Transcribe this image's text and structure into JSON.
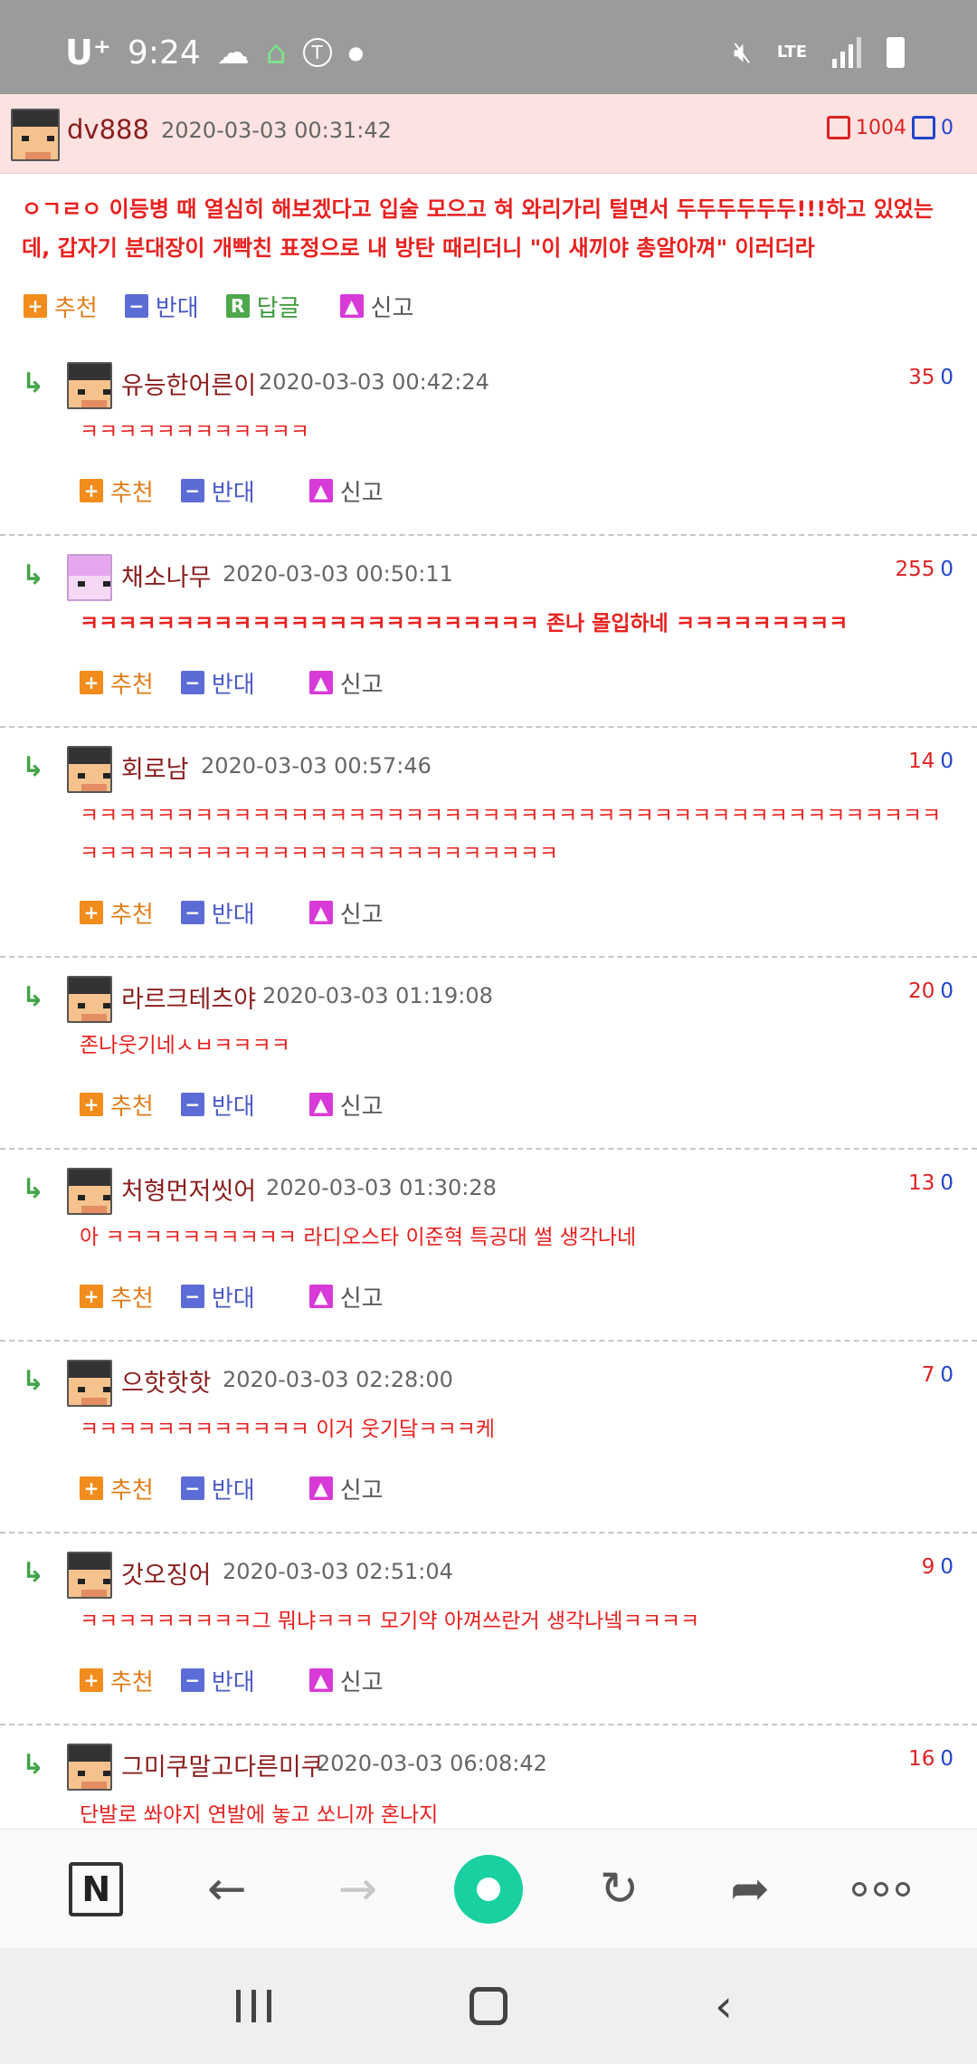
{
  "status_bar": {
    "carrier": "U⁺",
    "time": "9:24",
    "icons": [
      "weather-icon",
      "game-icon",
      "toon-blast-icon",
      "dot-icon",
      "mute-icon",
      "lte-icon",
      "signal-icon",
      "battery-icon"
    ],
    "lte": "LTE"
  },
  "post": {
    "user": "dv888",
    "date": "2020-03-03 00:31:42",
    "upvotes": "1004",
    "downvotes": "0",
    "text": "ㅇㄱㄹㅇ 이등병 때 열심히 해보겠다고 입술 모으고 혀 와리가리 털면서 두두두두두두!!!하고 있었는데, 갑자기 분대장이 개빡친 표정으로 내 방탄 때리더니 \"이 새끼야 총알아껴\" 이러더라",
    "actions": {
      "recommend": "추천",
      "oppose": "반대",
      "reply": "답글",
      "report": "신고"
    }
  },
  "comment_actions": {
    "recommend": "추천",
    "oppose": "반대",
    "report": "신고"
  },
  "comments": [
    {
      "user": "유능한어른이",
      "date": "2020-03-03 00:42:24",
      "up": "35",
      "down": "0",
      "text": "ㅋㅋㅋㅋㅋㅋㅋㅋㅋㅋㅋㅋ"
    },
    {
      "user": "채소나무",
      "date": "2020-03-03 00:50:11",
      "up": "255",
      "down": "0",
      "text": "ㅋㅋㅋㅋㅋㅋㅋㅋㅋㅋㅋㅋㅋㅋㅋㅋㅋㅋㅋㅋㅋㅋㅋㅋ 존나 몰입하네 ㅋㅋㅋㅋㅋㅋㅋㅋㅋ"
    },
    {
      "user": "회로남",
      "date": "2020-03-03 00:57:46",
      "up": "14",
      "down": "0",
      "text": "ㅋㅋㅋㅋㅋㅋㅋㅋㅋㅋㅋㅋㅋㅋㅋㅋㅋㅋㅋㅋㅋㅋㅋㅋㅋㅋㅋㅋㅋㅋㅋㅋㅋㅋㅋㅋㅋㅋㅋㅋㅋㅋㅋㅋㅋㅋㅋㅋㅋㅋㅋㅋㅋㅋㅋㅋㅋㅋㅋㅋㅋㅋㅋㅋㅋㅋㅋㅋㅋㅋ"
    },
    {
      "user": "라르크테츠야",
      "date": "2020-03-03 01:19:08",
      "up": "20",
      "down": "0",
      "text": "존나웃기네ㅅㅂㅋㅋㅋㅋ"
    },
    {
      "user": "처형먼저씻어",
      "date": "2020-03-03 01:30:28",
      "up": "13",
      "down": "0",
      "text": "아 ㅋㅋㅋㅋㅋㅋㅋㅋㅋㅋ 라디오스타 이준혁 특공대 썰 생각나네"
    },
    {
      "user": "으핫핫핫",
      "date": "2020-03-03 02:28:00",
      "up": "7",
      "down": "0",
      "text": "ㅋㅋㅋㅋㅋㅋㅋㅋㅋㅋㅋㅋ 이거 웃기닼ㅋㅋㅋ케"
    },
    {
      "user": "갓오징어",
      "date": "2020-03-03 02:51:04",
      "up": "9",
      "down": "0",
      "text": "ㅋㅋㅋㅋㅋㅋㅋㅋㅋ그 뭐냐ㅋㅋㅋ 모기약 아껴쓰란거 생각나넼ㅋㅋㅋㅋ"
    },
    {
      "user": "그미쿠말고다른미쿠",
      "date": "2020-03-03 06:08:42",
      "up": "16",
      "down": "0",
      "text": "단발로 쏴야지 연발에 놓고 쏘니까 혼나지"
    }
  ],
  "browser_bar": {
    "buttons": [
      "naver-home-icon",
      "back-arrow-icon",
      "forward-arrow-icon",
      "green-dot-icon",
      "refresh-icon",
      "share-icon",
      "more-icon"
    ],
    "naver_label": "N"
  },
  "system_nav": {
    "buttons": [
      "recent-apps-icon",
      "home-icon",
      "back-icon"
    ]
  },
  "colors": {
    "status_bar": "#9b9b9b",
    "post_bg": "#fde2e2",
    "comment_text": "#e8211f",
    "username": "#8a1d1d",
    "recommend": "#f28c1c",
    "oppose": "#5c6cd6",
    "reply": "#4da84b",
    "report": "#d83ad8",
    "accent": "#19d0a0"
  }
}
